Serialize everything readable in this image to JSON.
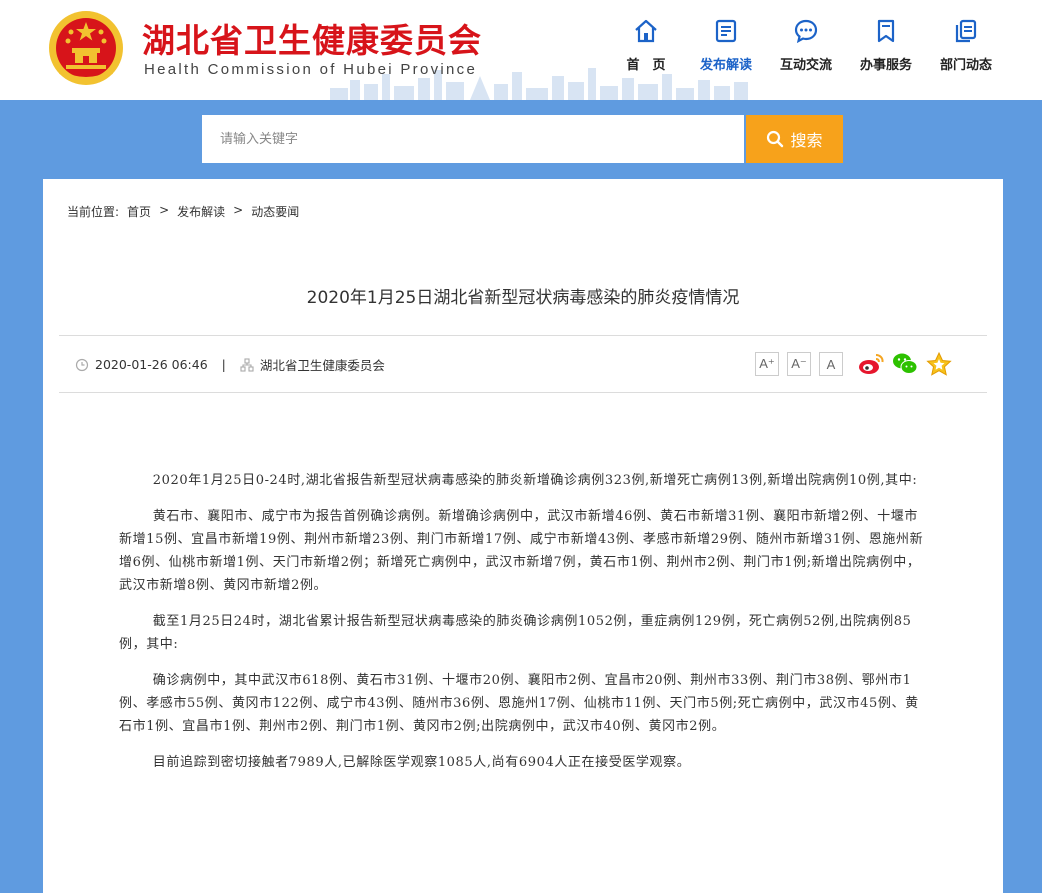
{
  "header": {
    "title": "湖北省卫生健康委员会",
    "subtitle": "Health Commission of Hubei Province",
    "nav": [
      {
        "label": "首　页",
        "icon": "home-icon"
      },
      {
        "label": "发布解读",
        "icon": "document-icon",
        "active": true
      },
      {
        "label": "互动交流",
        "icon": "chat-icon"
      },
      {
        "label": "办事服务",
        "icon": "bookmark-icon"
      },
      {
        "label": "部门动态",
        "icon": "copy-icon"
      }
    ]
  },
  "search": {
    "placeholder": "请输入关键字",
    "button_label": "搜索"
  },
  "breadcrumb": {
    "prefix": "当前位置:",
    "items": [
      "首页",
      "发布解读",
      "动态要闻"
    ],
    "separator": ">"
  },
  "article": {
    "title": "2020年1月25日湖北省新型冠状病毒感染的肺炎疫情情况",
    "date": "2020-01-26 06:46",
    "source": "湖北省卫生健康委员会",
    "font_sizes": [
      "A⁺",
      "A⁻",
      "A"
    ],
    "paragraphs": [
      "2020年1月25日0-24时,湖北省报告新型冠状病毒感染的肺炎新增确诊病例323例,新增死亡病例13例,新增出院病例10例,其中:",
      "黄石市、襄阳市、咸宁市为报告首例确诊病例。新增确诊病例中，武汉市新增46例、黄石市新增31例、襄阳市新增2例、十堰市新增15例、宜昌市新增19例、荆州市新增23例、荆门市新增17例、咸宁市新增43例、孝感市新增29例、随州市新增31例、恩施州新增6例、仙桃市新增1例、天门市新增2例；新增死亡病例中，武汉市新增7例，黄石市1例、荆州市2例、荆门市1例;新增出院病例中，武汉市新增8例、黄冈市新增2例。",
      "截至1月25日24时，湖北省累计报告新型冠状病毒感染的肺炎确诊病例1052例，重症病例129例，死亡病例52例,出院病例85例，其中:",
      "确诊病例中，其中武汉市618例、黄石市31例、十堰市20例、襄阳市2例、宜昌市20例、荆州市33例、荆门市38例、鄂州市1例、孝感市55例、黄冈市122例、咸宁市43例、随州市36例、恩施州17例、仙桃市11例、天门市5例;死亡病例中，武汉市45例、黄石市1例、宜昌市1例、荆州市2例、荆门市1例、黄冈市2例;出院病例中，武汉市40例、黄冈市2例。",
      "目前追踪到密切接触者7989人,已解除医学观察1085人,尚有6904人正在接受医学观察。"
    ]
  },
  "colors": {
    "brand_red": "#d7141a",
    "nav_blue": "#1c63c8",
    "background_blue": "#5f9be0",
    "search_orange": "#f7a21b"
  }
}
